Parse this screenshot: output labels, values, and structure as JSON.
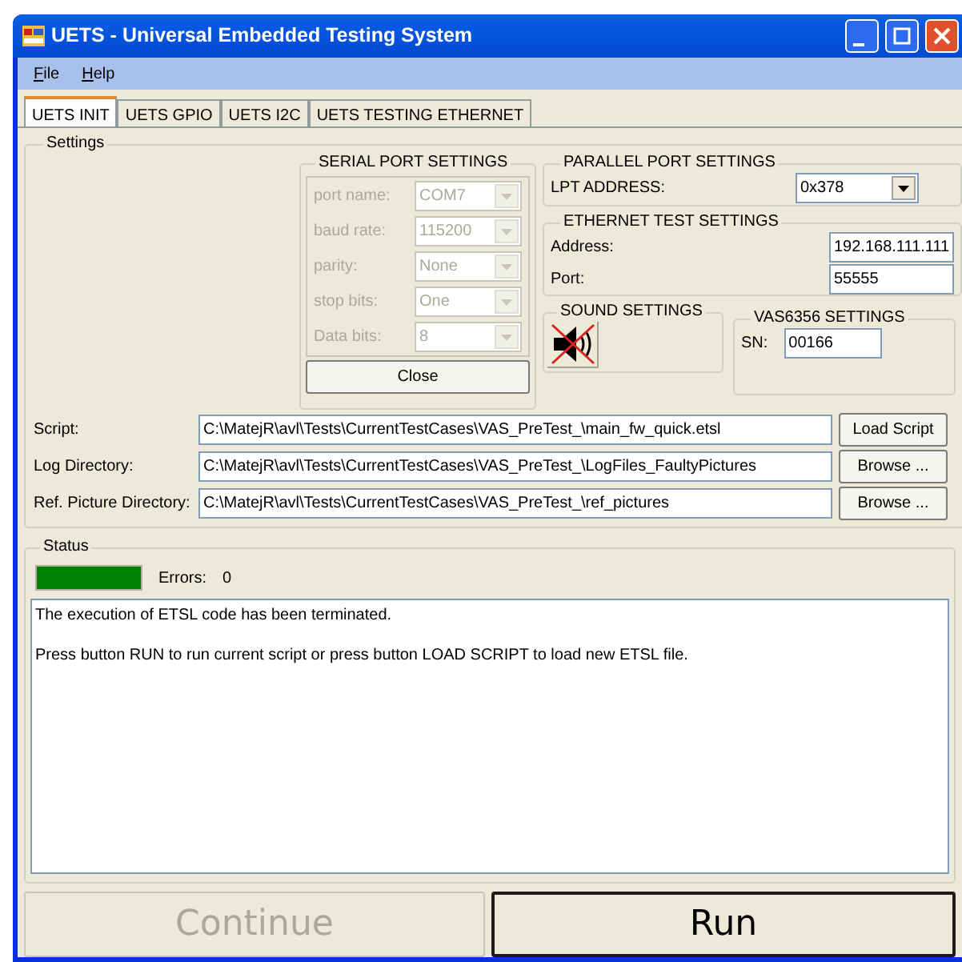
{
  "window": {
    "title": "UETS - Universal Embedded Testing System"
  },
  "menu": [
    "File",
    "Help"
  ],
  "tabs": [
    {
      "label": "UETS INIT",
      "selected": true
    },
    {
      "label": "UETS GPIO",
      "selected": false
    },
    {
      "label": "UETS I2C",
      "selected": false
    },
    {
      "label": "UETS TESTING ETHERNET",
      "selected": false
    }
  ],
  "settings": {
    "title": "Settings",
    "serial_port": {
      "title": "SERIAL PORT SETTINGS",
      "disabled": true,
      "fields": [
        {
          "label": "port name:",
          "value": "COM7"
        },
        {
          "label": "baud rate:",
          "value": "115200"
        },
        {
          "label": "parity:",
          "value": "None"
        },
        {
          "label": "stop bits:",
          "value": "One"
        },
        {
          "label": "Data bits:",
          "value": "8"
        }
      ],
      "close_button": "Close"
    },
    "parallel_port": {
      "title": "PARALLEL PORT SETTINGS",
      "label": "LPT ADDRESS:",
      "value": "0x378"
    },
    "ethernet": {
      "title": "ETHERNET TEST SETTINGS",
      "fields": [
        {
          "label": "Address:",
          "value": "192.168.111.111"
        },
        {
          "label": "Port:",
          "value": "55555"
        }
      ]
    },
    "sound": {
      "title": "SOUND SETTINGS",
      "muted": true
    },
    "vas": {
      "title": "VAS6356 SETTINGS",
      "label": "SN:",
      "value": "00166"
    },
    "paths": [
      {
        "label": "Script:",
        "value": "C:\\MatejR\\avl\\Tests\\CurrentTestCases\\VAS_PreTest_\\main_fw_quick.etsl",
        "button": "Load Script"
      },
      {
        "label": "Log Directory:",
        "value": "C:\\MatejR\\avl\\Tests\\CurrentTestCases\\VAS_PreTest_\\LogFiles_FaultyPictures",
        "button": "Browse ..."
      },
      {
        "label": "Ref. Picture Directory:",
        "value": "C:\\MatejR\\avl\\Tests\\CurrentTestCases\\VAS_PreTest_\\ref_pictures",
        "button": "Browse ..."
      }
    ]
  },
  "status": {
    "title": "Status",
    "level": 1,
    "errors_label": "Errors:",
    "errors": "0",
    "log": [
      "The execution of ETSL code has been terminated.",
      "Press button RUN to run current script or press button LOAD SCRIPT to load new ETSL file."
    ]
  },
  "buttons": [
    {
      "label": "Continue",
      "disabled": true
    },
    {
      "label": "Run",
      "disabled": false
    }
  ]
}
